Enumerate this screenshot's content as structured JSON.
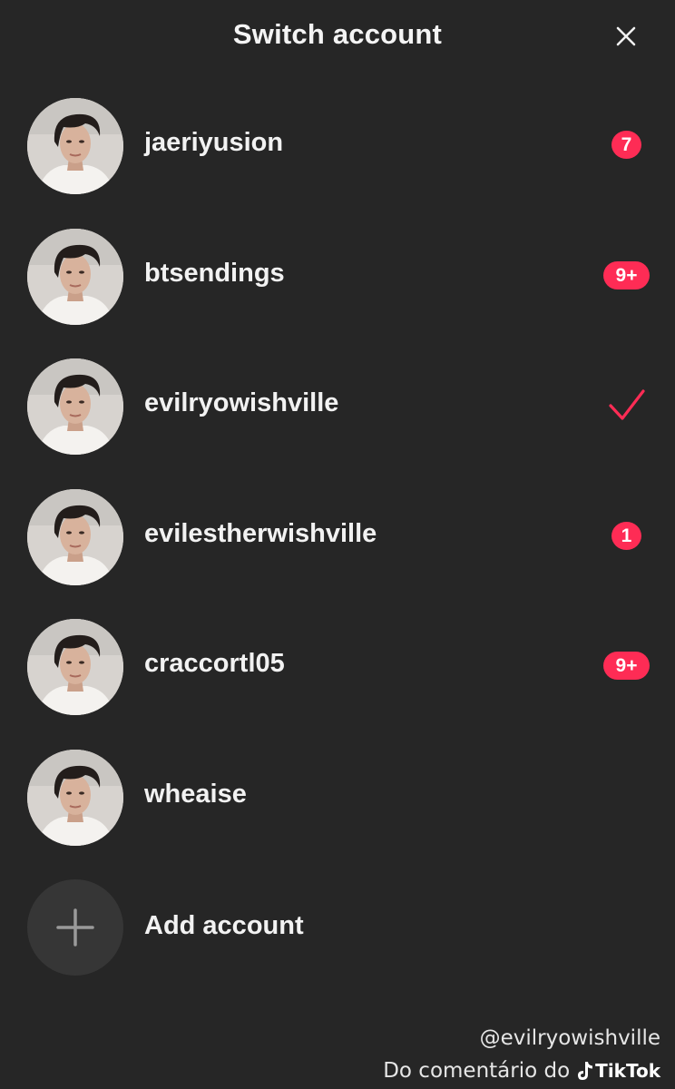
{
  "header": {
    "title": "Switch account",
    "close_icon": "close-icon"
  },
  "accounts": [
    {
      "username": "jaeriyusion",
      "badge": "7"
    },
    {
      "username": "btsendings",
      "badge": "9+"
    },
    {
      "username": "evilryowishville",
      "selected": true
    },
    {
      "username": "evilestherwishville",
      "badge": "1"
    },
    {
      "username": "craccortl05",
      "badge": "9+"
    },
    {
      "username": "wheaise"
    }
  ],
  "add_account": {
    "label": "Add account",
    "icon": "plus-icon"
  },
  "colors": {
    "background": "#262626",
    "accent": "#fe2c55",
    "text": "#f2f2f2"
  },
  "watermark": {
    "handle": "@evilryowishville",
    "caption": "Do comentário do",
    "logo_text": "TikTok"
  }
}
